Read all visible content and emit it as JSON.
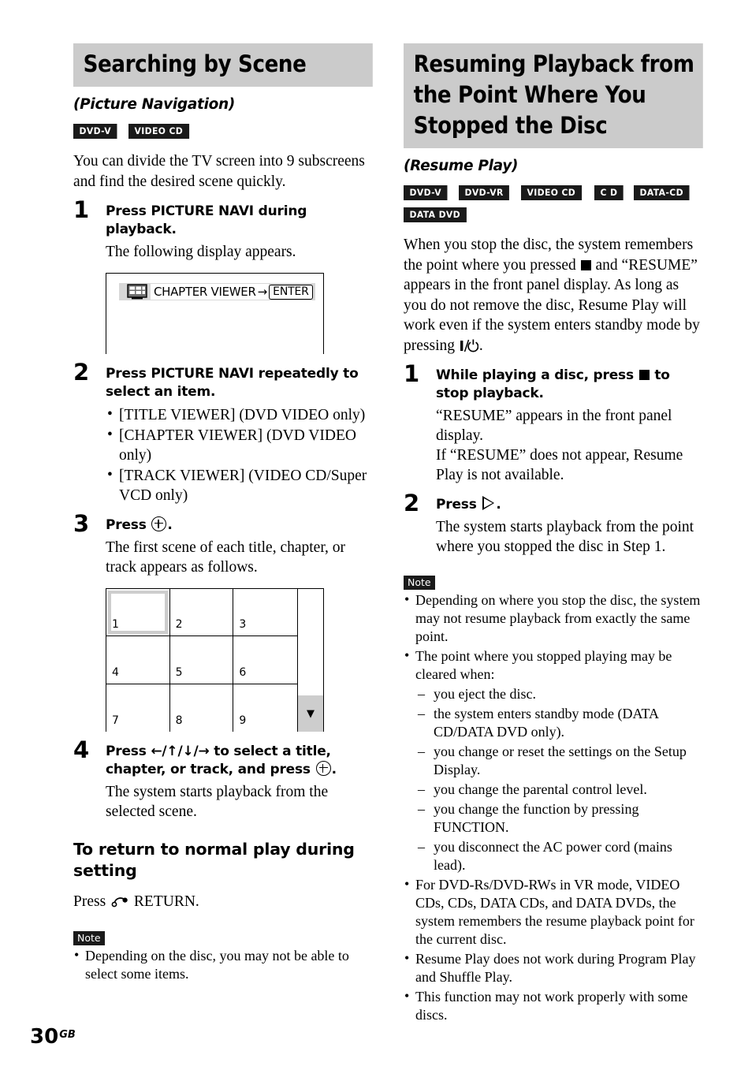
{
  "page": {
    "number": "30",
    "region_suffix": "GB"
  },
  "left_column": {
    "heading": "Searching by Scene",
    "subheading": "(Picture Navigation)",
    "badges": [
      "DVD-V",
      "VIDEO CD"
    ],
    "intro": "You can divide the TV screen into 9 subscreens and find the desired scene quickly.",
    "steps": [
      {
        "number": "1",
        "title": "Press PICTURE NAVI during playback.",
        "desc": "The following display appears."
      },
      {
        "number": "2",
        "title": "Press PICTURE NAVI repeatedly to select an item.",
        "bullets": [
          "[TITLE VIEWER] (DVD VIDEO only)",
          "[CHAPTER VIEWER] (DVD VIDEO only)",
          "[TRACK VIEWER] (VIDEO CD/Super VCD only)"
        ]
      },
      {
        "number": "3",
        "title_prefix": "Press",
        "title_suffix": ".",
        "desc": "The first scene of each title, chapter, or track appears as follows."
      },
      {
        "number": "4",
        "title_part1": "Press",
        "title_arrows": "←/↑/↓/→",
        "title_part2": "to select a title, chapter, or track, and press",
        "title_part3": ".",
        "desc": "The system starts playback from the selected scene."
      }
    ],
    "display_mock": {
      "icon_name": "chapter-viewer-screen-icon",
      "label": "CHAPTER VIEWER",
      "arrow": "→",
      "button": "ENTER"
    },
    "scene_grid": {
      "cells": [
        "1",
        "2",
        "3",
        "4",
        "5",
        "6",
        "7",
        "8",
        "9"
      ],
      "selected_index": 0,
      "scroll_arrow": "▼"
    },
    "return_section": {
      "heading": "To return to normal play during setting",
      "text_prefix": "Press",
      "text_suffix": "RETURN."
    },
    "note": {
      "tag": "Note",
      "items": [
        "Depending on the disc, you may not be able to select some items."
      ]
    }
  },
  "right_column": {
    "heading": "Resuming Playback from the Point Where You Stopped the Disc",
    "subheading": "(Resume Play)",
    "badges": [
      "DVD-V",
      "DVD-VR",
      "VIDEO CD",
      "C D",
      "DATA-CD",
      "DATA DVD"
    ],
    "intro_part1": "When you stop the disc, the system remembers the point where you pressed",
    "intro_part2": "and “RESUME” appears in the front panel display. As long as you do not remove the disc, Resume Play will work even if the system enters standby mode by pressing",
    "intro_part3": ".",
    "steps": [
      {
        "number": "1",
        "title_part1": "While playing a disc, press",
        "title_part2": "to stop playback.",
        "desc_line1": "“RESUME” appears in the front panel display.",
        "desc_line2": "If “RESUME” does not appear, Resume Play is not available."
      },
      {
        "number": "2",
        "title_prefix": "Press",
        "title_suffix": ".",
        "desc": "The system starts playback from the point where you stopped the disc in Step 1."
      }
    ],
    "note": {
      "tag": "Note",
      "items": [
        {
          "text": "Depending on where you stop the disc, the system may not resume playback from exactly the same point."
        },
        {
          "text": "The point where you stopped playing may be cleared when:",
          "sub": [
            "you eject the disc.",
            "the system enters standby mode (DATA CD/DATA DVD only).",
            "you change or reset the settings on the Setup Display.",
            "you change the parental control level.",
            "you change the function by pressing FUNCTION.",
            "you disconnect the AC power cord (mains lead)."
          ]
        },
        {
          "text": "For DVD-Rs/DVD-RWs in VR mode, VIDEO CDs, CDs, DATA CDs, and DATA DVDs, the system remembers the resume playback point for the current disc."
        },
        {
          "text": "Resume Play does not work during Program Play and Shuffle Play."
        },
        {
          "text": "This function may not work properly with some discs."
        }
      ]
    }
  }
}
